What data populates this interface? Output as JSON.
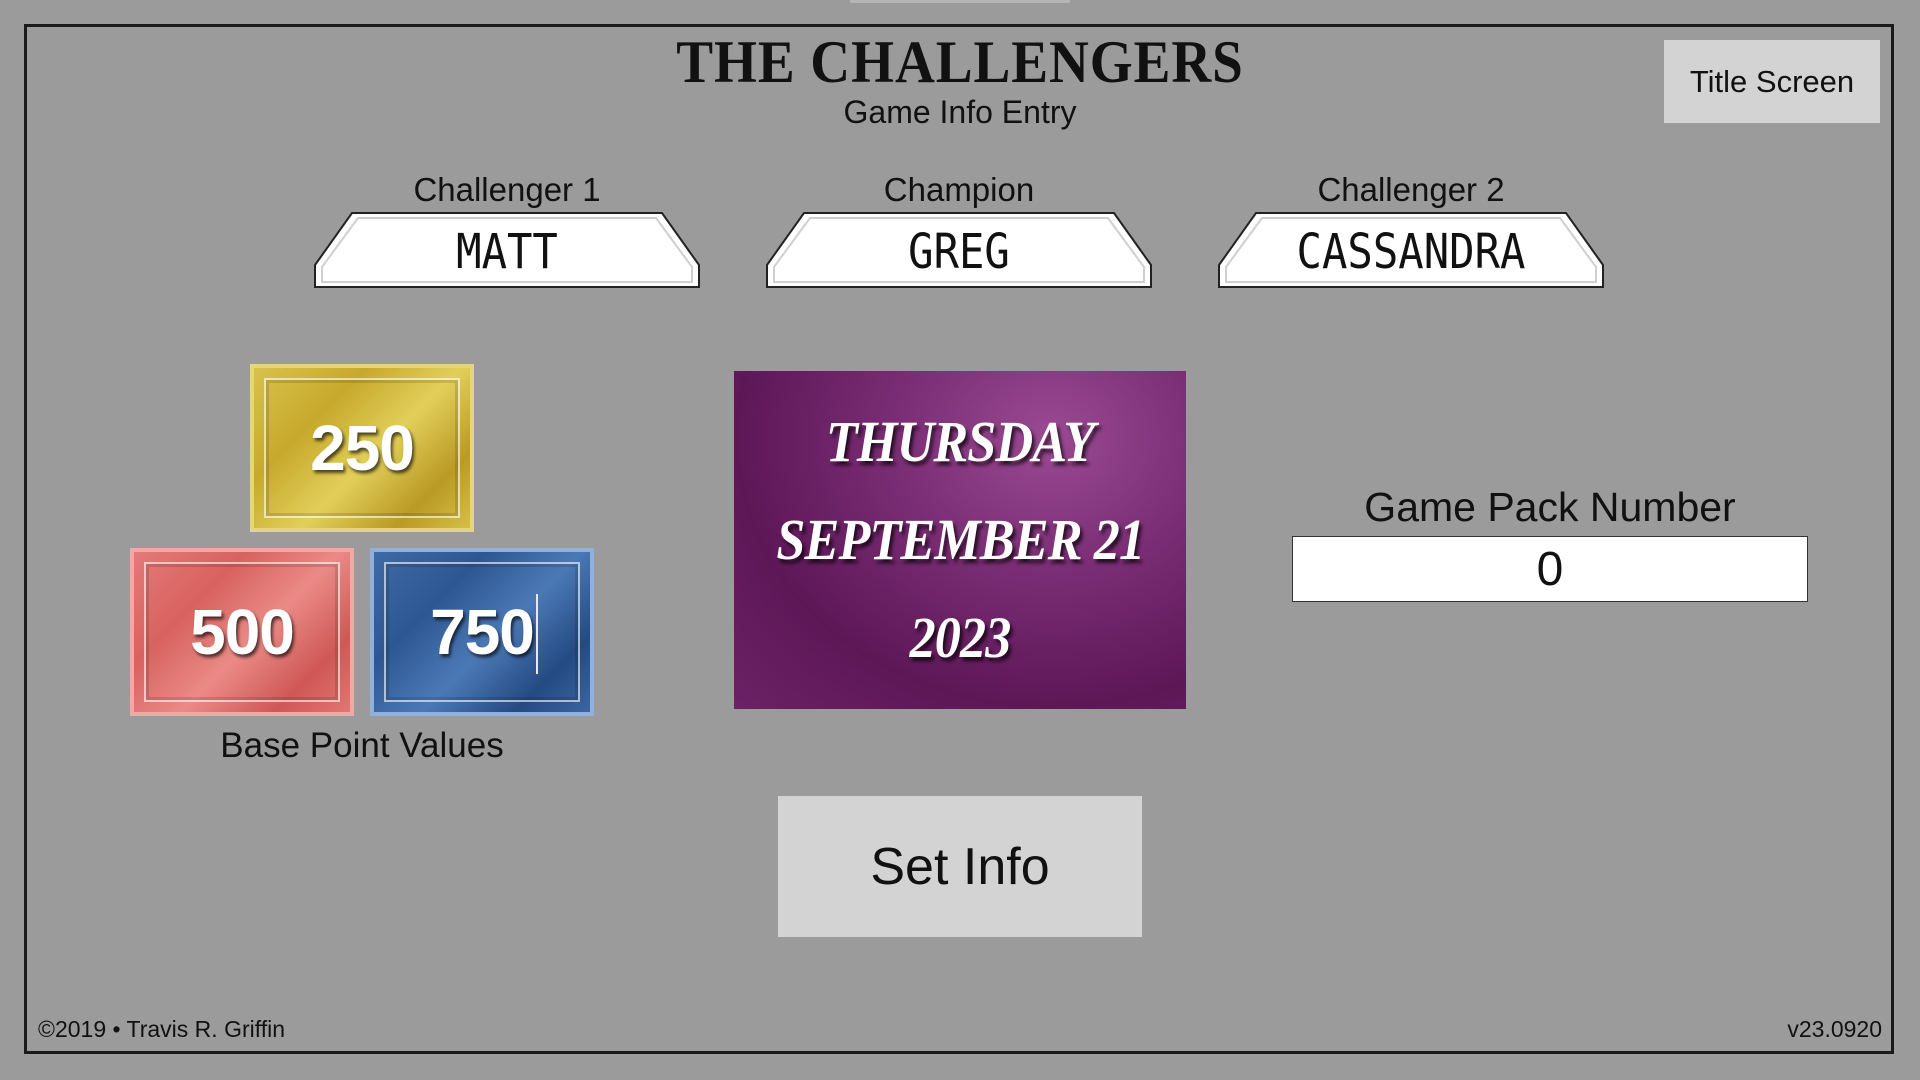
{
  "header": {
    "title": "THE CHALLENGERS",
    "subtitle": "Game Info Entry",
    "title_screen_label": "Title Screen"
  },
  "players": [
    {
      "label": "Challenger 1",
      "name": "MATT"
    },
    {
      "label": "Champion",
      "name": "GREG"
    },
    {
      "label": "Challenger 2",
      "name": "CASSANDRA"
    }
  ],
  "base_points": {
    "values": [
      "250",
      "500",
      "750"
    ],
    "label": "Base Point Values",
    "colors": {
      "gold": "#d0b83c",
      "red": "#dc6a67",
      "blue": "#3561a0"
    }
  },
  "date_card": {
    "day": "THURSDAY",
    "month_day": "SEPTEMBER 21",
    "year": "2023",
    "color": "#6e2468"
  },
  "game_pack": {
    "label": "Game Pack Number",
    "value": "0"
  },
  "actions": {
    "set_info_label": "Set Info"
  },
  "footer": {
    "copyright": "©2019 • Travis R. Griffin",
    "version": "v23.0920"
  }
}
